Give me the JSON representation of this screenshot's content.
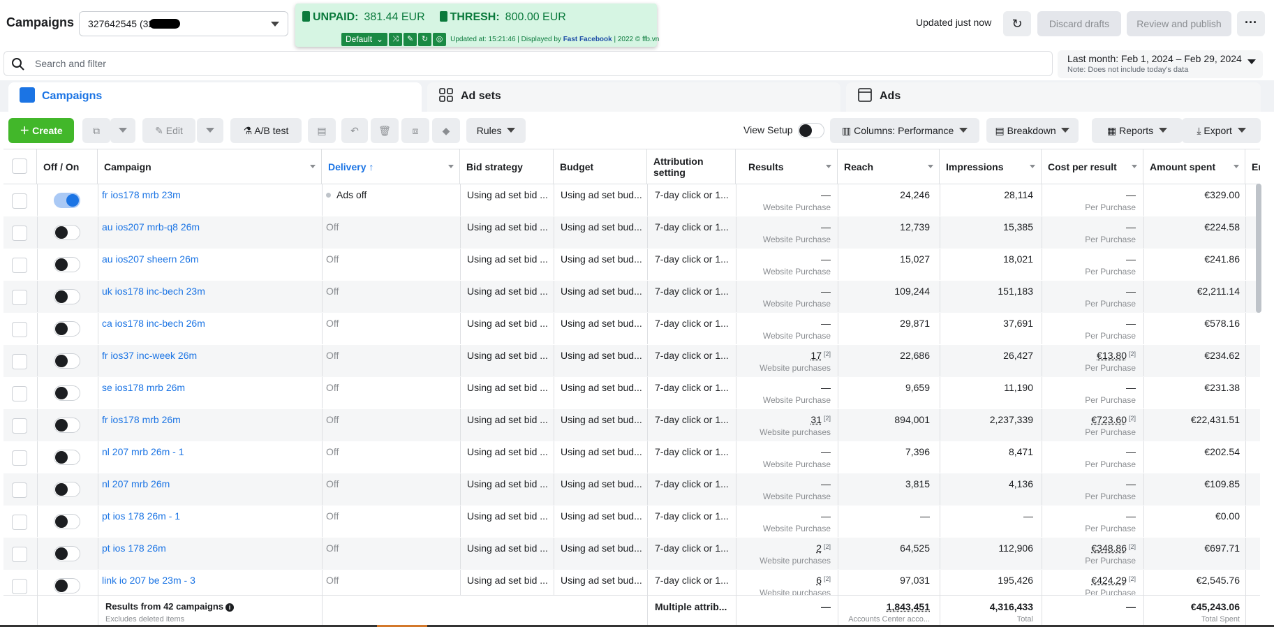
{
  "header": {
    "title": "Campaigns",
    "account_selector": "327642545 (32764",
    "updated": "Updated just now",
    "discard": "Discard drafts",
    "review": "Review and publish",
    "more": "···"
  },
  "extension": {
    "unpaid_label": "UNPAID:",
    "unpaid_value": "381.44 EUR",
    "thresh_label": "THRESH:",
    "thresh_value": "800.00 EUR",
    "profile": "Default",
    "status_prefix": "Updated at: 15:21:46 | Displayed by ",
    "status_brand": "Fast Facebook",
    "status_suffix": " | 2022 © ffb.vn",
    "colors": {
      "bg": "#d6f5e3",
      "accent": "#1a8a44"
    }
  },
  "search": {
    "placeholder": "Search and filter"
  },
  "date_range": {
    "label": "Last month: Feb 1, 2024 – Feb 29, 2024",
    "note": "Note: Does not include today's data"
  },
  "tabs": [
    {
      "label": "Campaigns",
      "active": true
    },
    {
      "label": "Ad sets",
      "active": false
    },
    {
      "label": "Ads",
      "active": false
    }
  ],
  "toolbar": {
    "create": "Create",
    "edit": "Edit",
    "ab_test": "A/B test",
    "rules": "Rules",
    "view_setup": "View Setup",
    "columns": "Columns: Performance",
    "breakdown": "Breakdown",
    "reports": "Reports",
    "export": "Export"
  },
  "columns": {
    "offon": "Off / On",
    "campaign": "Campaign",
    "delivery": "Delivery ↑",
    "bid_strategy": "Bid strategy",
    "budget": "Budget",
    "attribution": "Attribution setting",
    "results": "Results",
    "reach": "Reach",
    "impressions": "Impressions",
    "cpr": "Cost per result",
    "amount_spent": "Amount spent",
    "ends": "End"
  },
  "rows": [
    {
      "on": true,
      "name": "fr ios178 mrb 23m",
      "delivery": "Ads off",
      "bid": "Using ad set bid ...",
      "budget": "Using ad set bud...",
      "attr": "7-day click or 1...",
      "results": "—",
      "results_sub": "Website Purchase",
      "reach": "24,246",
      "impressions": "28,114",
      "cpr": "—",
      "cpr_sub": "Per Purchase",
      "spent": "€329.00"
    },
    {
      "on": false,
      "name": "au ios207 mrb-q8 26m",
      "delivery": "Off",
      "bid": "Using ad set bid ...",
      "budget": "Using ad set bud...",
      "attr": "7-day click or 1...",
      "results": "—",
      "results_sub": "Website Purchase",
      "reach": "12,739",
      "impressions": "15,385",
      "cpr": "—",
      "cpr_sub": "Per Purchase",
      "spent": "€224.58"
    },
    {
      "on": false,
      "name": "au ios207 sheern 26m",
      "delivery": "Off",
      "bid": "Using ad set bid ...",
      "budget": "Using ad set bud...",
      "attr": "7-day click or 1...",
      "results": "—",
      "results_sub": "Website Purchase",
      "reach": "15,027",
      "impressions": "18,021",
      "cpr": "—",
      "cpr_sub": "Per Purchase",
      "spent": "€241.86"
    },
    {
      "on": false,
      "name": "uk ios178 inc-bech 23m",
      "delivery": "Off",
      "bid": "Using ad set bid ...",
      "budget": "Using ad set bud...",
      "attr": "7-day click or 1...",
      "results": "—",
      "results_sub": "Website Purchase",
      "reach": "109,244",
      "impressions": "151,183",
      "cpr": "—",
      "cpr_sub": "Per Purchase",
      "spent": "€2,211.14"
    },
    {
      "on": false,
      "name": "ca ios178 inc-bech 26m",
      "delivery": "Off",
      "bid": "Using ad set bid ...",
      "budget": "Using ad set bud...",
      "attr": "7-day click or 1...",
      "results": "—",
      "results_sub": "Website Purchase",
      "reach": "29,871",
      "impressions": "37,691",
      "cpr": "—",
      "cpr_sub": "Per Purchase",
      "spent": "€578.16"
    },
    {
      "on": false,
      "name": "fr ios37 inc-week 26m",
      "delivery": "Off",
      "bid": "Using ad set bid ...",
      "budget": "Using ad set bud...",
      "attr": "7-day click or 1...",
      "results": "17",
      "results_sub": "Website purchases",
      "reach": "22,686",
      "impressions": "26,427",
      "cpr": "€13.80",
      "cpr_sub": "Per Purchase",
      "spent": "€234.62"
    },
    {
      "on": false,
      "name": "se ios178 mrb 26m",
      "delivery": "Off",
      "bid": "Using ad set bid ...",
      "budget": "Using ad set bud...",
      "attr": "7-day click or 1...",
      "results": "—",
      "results_sub": "Website Purchase",
      "reach": "9,659",
      "impressions": "11,190",
      "cpr": "—",
      "cpr_sub": "Per Purchase",
      "spent": "€231.38"
    },
    {
      "on": false,
      "name": "fr ios178 mrb 26m",
      "delivery": "Off",
      "bid": "Using ad set bid ...",
      "budget": "Using ad set bud...",
      "attr": "7-day click or 1...",
      "results": "31",
      "results_sub": "Website purchases",
      "reach": "894,001",
      "impressions": "2,237,339",
      "cpr": "€723.60",
      "cpr_sub": "Per Purchase",
      "spent": "€22,431.51"
    },
    {
      "on": false,
      "name": "nl 207 mrb 26m - 1",
      "delivery": "Off",
      "bid": "Using ad set bid ...",
      "budget": "Using ad set bud...",
      "attr": "7-day click or 1...",
      "results": "—",
      "results_sub": "Website Purchase",
      "reach": "7,396",
      "impressions": "8,471",
      "cpr": "—",
      "cpr_sub": "Per Purchase",
      "spent": "€202.54"
    },
    {
      "on": false,
      "name": "nl 207 mrb 26m",
      "delivery": "Off",
      "bid": "Using ad set bid ...",
      "budget": "Using ad set bud...",
      "attr": "7-day click or 1...",
      "results": "—",
      "results_sub": "Website Purchase",
      "reach": "3,815",
      "impressions": "4,136",
      "cpr": "—",
      "cpr_sub": "Per Purchase",
      "spent": "€109.85"
    },
    {
      "on": false,
      "name": "pt ios 178 26m - 1",
      "delivery": "Off",
      "bid": "Using ad set bid ...",
      "budget": "Using ad set bud...",
      "attr": "7-day click or 1...",
      "results": "—",
      "results_sub": "Website Purchase",
      "reach": "—",
      "impressions": "—",
      "cpr": "—",
      "cpr_sub": "Per Purchase",
      "spent": "€0.00"
    },
    {
      "on": false,
      "name": "pt ios 178 26m",
      "delivery": "Off",
      "bid": "Using ad set bid ...",
      "budget": "Using ad set bud...",
      "attr": "7-day click or 1...",
      "results": "2",
      "results_sub": "Website purchases",
      "reach": "64,525",
      "impressions": "112,906",
      "cpr": "€348.86",
      "cpr_sub": "Per Purchase",
      "spent": "€697.71"
    },
    {
      "on": false,
      "name": "link io 207 be 23m - 3",
      "delivery": "Off",
      "bid": "Using ad set bid ...",
      "budget": "Using ad set bud...",
      "attr": "7-day click or 1...",
      "results": "6",
      "results_sub": "Website purchases",
      "reach": "97,031",
      "impressions": "195,426",
      "cpr": "€424.29",
      "cpr_sub": "Per Purchase",
      "spent": "€2,545.76"
    }
  ],
  "footer": {
    "title": "Results from 42 campaigns",
    "subtitle": "Excludes deleted items",
    "attribution": "Multiple attrib...",
    "results": "—",
    "reach": "1,843,451",
    "reach_sub": "Accounts Center acco...",
    "impressions": "4,316,433",
    "impressions_sub": "Total",
    "cpr": "—",
    "spent": "€45,243.06",
    "spent_sub": "Total Spent"
  },
  "colors": {
    "accent": "#1b74e4",
    "create": "#42b72a"
  }
}
